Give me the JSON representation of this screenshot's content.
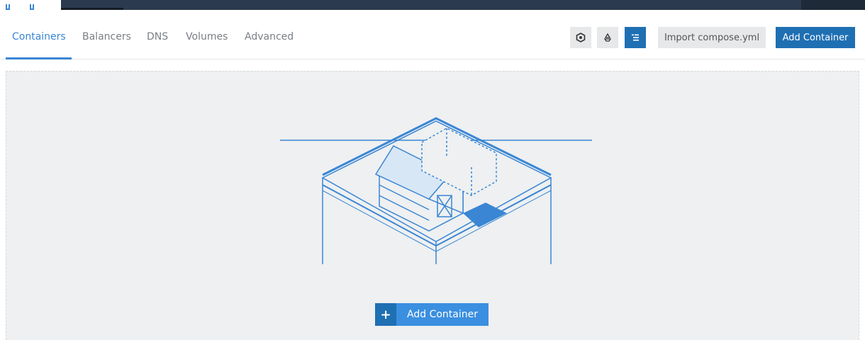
{
  "tabs": [
    {
      "label": "Containers",
      "active": true
    },
    {
      "label": "Balancers",
      "active": false
    },
    {
      "label": "DNS",
      "active": false
    },
    {
      "label": "Volumes",
      "active": false
    },
    {
      "label": "Advanced",
      "active": false
    }
  ],
  "toolbar": {
    "icons": [
      "hexagon-icon",
      "recycle-icon",
      "list-tree-icon"
    ],
    "import_label": "Import compose.yml",
    "add_label": "Add Container"
  },
  "empty_state": {
    "illustration": "barn-farm-illustration",
    "add_label": "Add Container",
    "plus_symbol": "+"
  },
  "colors": {
    "accent": "#3a86d4",
    "primary_button": "#1f6fb3",
    "topbar": "#2b3a4e",
    "panel_bg": "#eef0f1"
  }
}
